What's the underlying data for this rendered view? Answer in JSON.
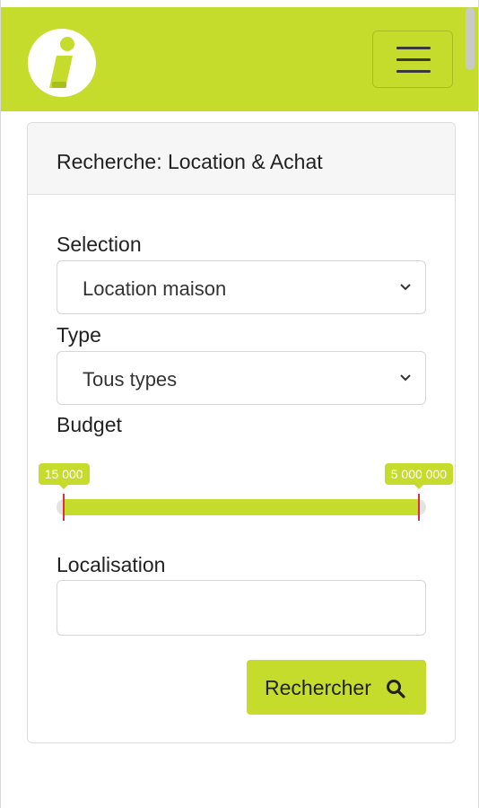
{
  "header": {
    "logo_icon": "info-logo-icon",
    "menu_icon": "hamburger-menu-icon",
    "brand_color": "#c5dc2d"
  },
  "search_card": {
    "title": "Recherche: Location & Achat",
    "selection": {
      "label": "Selection",
      "value": "Location maison"
    },
    "type": {
      "label": "Type",
      "value": "Tous types"
    },
    "budget": {
      "label": "Budget",
      "min_label": "15 000",
      "max_label": "5 000 000",
      "min_fraction": 0.02,
      "max_fraction": 0.98
    },
    "location": {
      "label": "Localisation",
      "value": ""
    },
    "submit": {
      "label": "Rechercher",
      "icon": "search-icon"
    }
  }
}
